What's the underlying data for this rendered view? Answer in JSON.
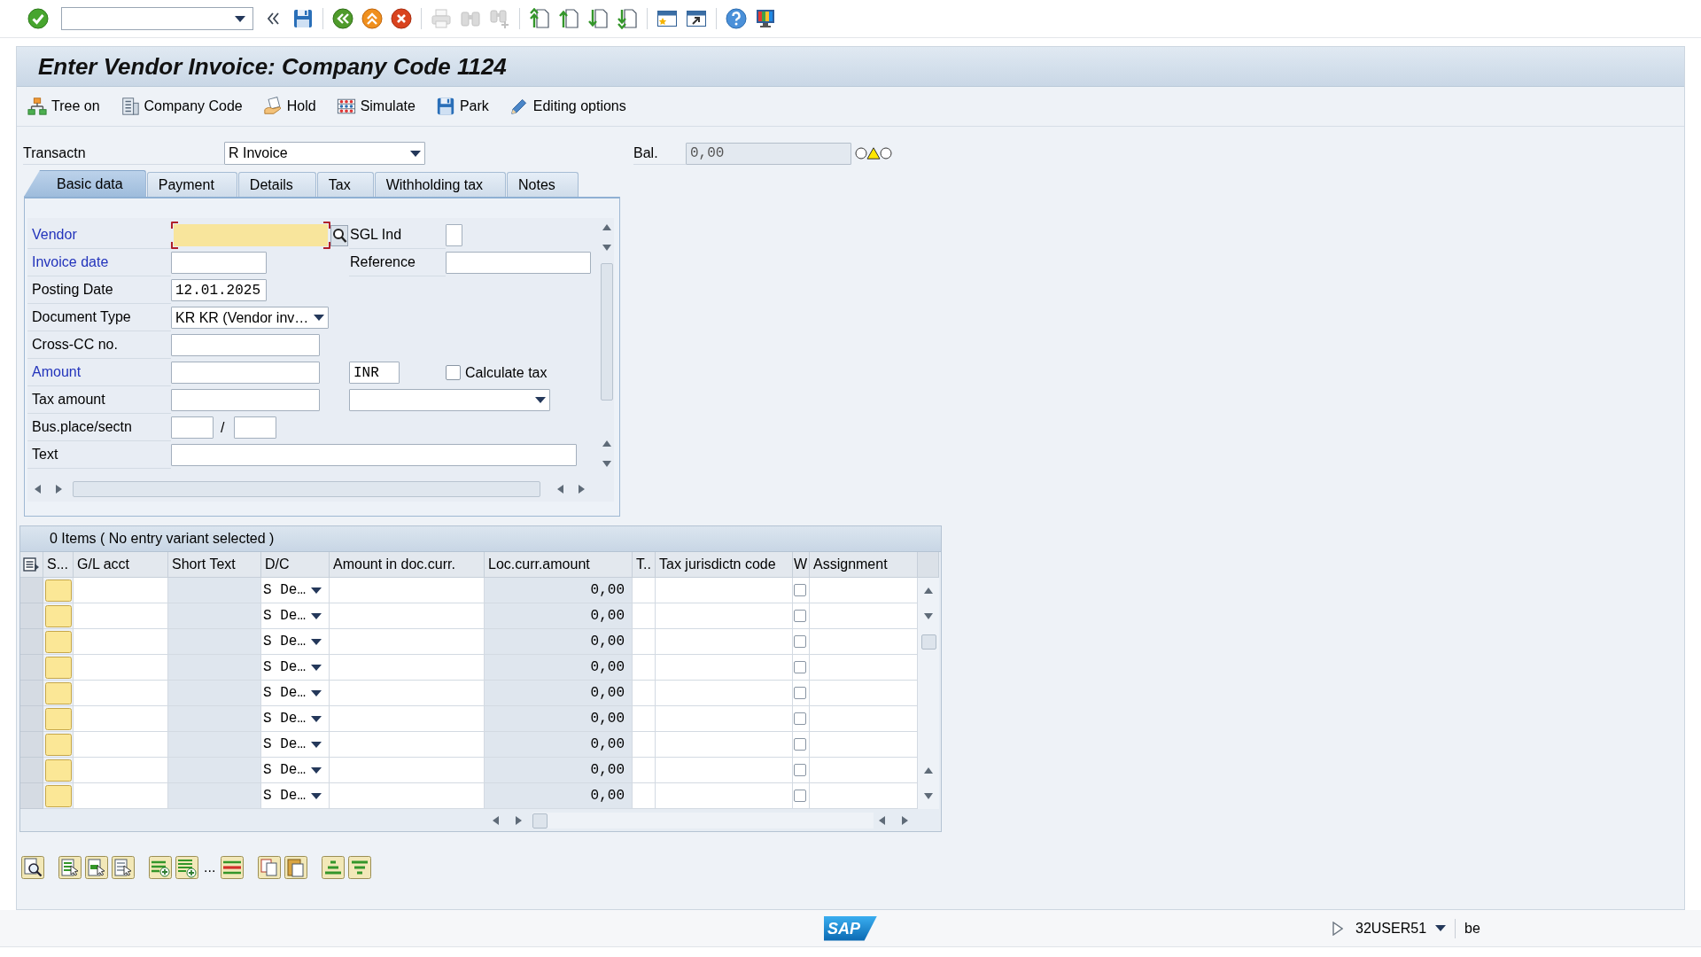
{
  "system_toolbar": [
    [
      {
        "kind": "enter",
        "disabled": false
      },
      {
        "kind": "command",
        "disabled": false
      },
      {
        "kind": "collapse",
        "disabled": false
      },
      {
        "kind": "save",
        "disabled": false
      }
    ],
    [
      {
        "kind": "back",
        "disabled": false
      },
      {
        "kind": "exit",
        "disabled": false
      },
      {
        "kind": "cancel",
        "disabled": false
      }
    ],
    [
      {
        "kind": "print",
        "disabled": true
      },
      {
        "kind": "find",
        "disabled": true
      },
      {
        "kind": "findnext",
        "disabled": true
      }
    ],
    [
      {
        "kind": "firstpage",
        "disabled": false
      },
      {
        "kind": "prevpage",
        "disabled": false
      },
      {
        "kind": "nextpage",
        "disabled": false
      },
      {
        "kind": "lastpage",
        "disabled": false
      }
    ],
    [
      {
        "kind": "newsession",
        "disabled": false
      },
      {
        "kind": "shortcut",
        "disabled": false
      }
    ],
    [
      {
        "kind": "help",
        "disabled": false
      },
      {
        "kind": "layout",
        "disabled": false
      }
    ]
  ],
  "window": {
    "title": "Enter Vendor Invoice: Company Code 1124"
  },
  "app_toolbar": [
    {
      "kind": "tree",
      "label": "Tree on"
    },
    {
      "kind": "company",
      "label": "Company Code"
    },
    {
      "kind": "hold",
      "label": "Hold"
    },
    {
      "kind": "simulate",
      "label": "Simulate"
    },
    {
      "kind": "park",
      "label": "Park"
    },
    {
      "kind": "options",
      "label": "Editing options"
    }
  ],
  "header": {
    "transaction": {
      "label": "Transactn",
      "value": "R Invoice"
    },
    "balance": {
      "label": "Bal.",
      "value": "0,00",
      "warning": true
    }
  },
  "tabs": [
    {
      "label": "Basic data",
      "selected": true
    },
    {
      "label": "Payment",
      "selected": false
    },
    {
      "label": "Details",
      "selected": false
    },
    {
      "label": "Tax",
      "selected": false
    },
    {
      "label": "Withholding tax",
      "selected": false
    },
    {
      "label": "Notes",
      "selected": false
    }
  ],
  "basic_data": {
    "rows": [
      {
        "label": "Vendor",
        "required": true,
        "field": {
          "kind": "search",
          "focused": true
        },
        "side": [
          {
            "kind": "flag",
            "label": "SGL Ind"
          }
        ]
      },
      {
        "label": "Invoice date",
        "required": true,
        "field": {
          "kind": "date",
          "focused": false
        },
        "side": [
          {
            "kind": "text",
            "label": "Reference"
          }
        ]
      },
      {
        "label": "Posting Date",
        "required": false,
        "field": {
          "kind": "date",
          "focused": false,
          "value": "12.01.2025"
        }
      },
      {
        "label": "Document Type",
        "required": false,
        "field": {
          "kind": "dropdown",
          "focused": false,
          "value": "KR KR (Vendor inv…"
        }
      },
      {
        "label": "Cross-CC no.",
        "required": false,
        "field": {
          "kind": "input",
          "focused": false
        }
      },
      {
        "label": "Amount",
        "required": true,
        "field": {
          "kind": "input",
          "focused": false
        },
        "side": [
          {
            "kind": "currency",
            "value": "INR"
          },
          {
            "kind": "checkbox",
            "label": "Calculate tax",
            "checked": false
          }
        ]
      },
      {
        "label": "Tax amount",
        "required": false,
        "field": {
          "kind": "input",
          "focused": false
        },
        "side": [
          {
            "kind": "dropdown"
          }
        ]
      },
      {
        "label": "Bus.place/sectn",
        "required": false,
        "field": {
          "kind": "split",
          "focused": false,
          "separator": "/"
        }
      },
      {
        "label": "Text",
        "required": false,
        "field": {
          "kind": "long",
          "focused": false
        }
      }
    ]
  },
  "items_table": {
    "title": "0 Items ( No entry variant selected )",
    "columns": [
      "S...",
      "G/L acct",
      "Short Text",
      "D/C",
      "Amount in doc.curr.",
      "Loc.curr.amount",
      "T..",
      "Tax jurisdictn code",
      "W",
      "Assignment"
    ],
    "rows": [
      {
        "dc": "S De…",
        "loc_amount": "0,00",
        "w_checked": false
      },
      {
        "dc": "S De…",
        "loc_amount": "0,00",
        "w_checked": false
      },
      {
        "dc": "S De…",
        "loc_amount": "0,00",
        "w_checked": false
      },
      {
        "dc": "S De…",
        "loc_amount": "0,00",
        "w_checked": false
      },
      {
        "dc": "S De…",
        "loc_amount": "0,00",
        "w_checked": false
      },
      {
        "dc": "S De…",
        "loc_amount": "0,00",
        "w_checked": false
      },
      {
        "dc": "S De…",
        "loc_amount": "0,00",
        "w_checked": false
      },
      {
        "dc": "S De…",
        "loc_amount": "0,00",
        "w_checked": false
      },
      {
        "dc": "S De…",
        "loc_amount": "0,00",
        "w_checked": false
      }
    ]
  },
  "table_toolbar": [
    [
      {
        "kind": "details"
      }
    ],
    [
      {
        "kind": "selectall"
      },
      {
        "kind": "selectblock"
      },
      {
        "kind": "deselectall"
      }
    ],
    [
      {
        "kind": "insertrow"
      },
      {
        "kind": "insertrows"
      },
      {
        "kind": "more",
        "label": "..."
      },
      {
        "kind": "deleterow"
      }
    ],
    [
      {
        "kind": "copy"
      },
      {
        "kind": "paste"
      }
    ],
    [
      {
        "kind": "sortup"
      },
      {
        "kind": "sortdown"
      }
    ]
  ],
  "status_bar": {
    "logo": "SAP",
    "user": "32USER51",
    "server": "be"
  }
}
